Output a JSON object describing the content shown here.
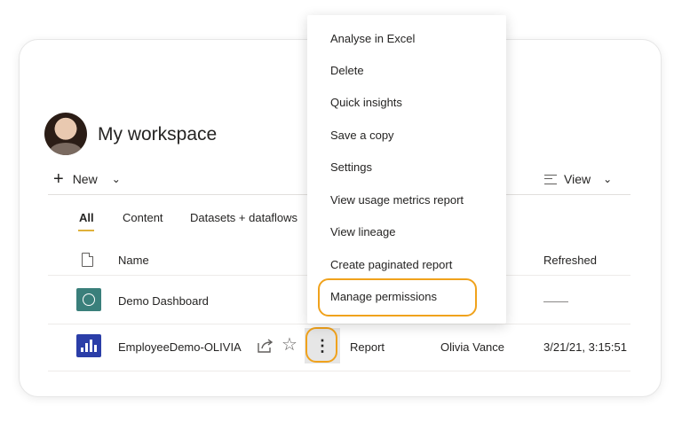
{
  "workspace": {
    "title": "My workspace"
  },
  "toolbar": {
    "new_label": "New",
    "plus": "+",
    "chevron": "⌄",
    "view_label": "View"
  },
  "tabs": [
    {
      "label": "All",
      "active": true
    },
    {
      "label": "Content",
      "active": false
    },
    {
      "label": "Datasets + dataflows",
      "active": false
    }
  ],
  "table": {
    "headers": {
      "name": "Name",
      "refreshed": "Refreshed"
    },
    "rows": [
      {
        "name": "Demo Dashboard",
        "type": "",
        "owner": "",
        "refreshed": ""
      },
      {
        "name": "EmployeeDemo-OLIVIA",
        "type": "Report",
        "owner": "Olivia Vance",
        "refreshed": "3/21/21, 3:15:51"
      }
    ]
  },
  "row_actions": {
    "more_glyph": "⋮",
    "star_glyph": "☆"
  },
  "context_menu": {
    "items": [
      "Analyse in Excel",
      "Delete",
      "Quick insights",
      "Save a copy",
      "Settings",
      "View usage metrics report",
      "View lineage",
      "Create paginated report",
      "Manage permissions"
    ]
  },
  "colors": {
    "highlight": "#f0a21c",
    "tab_underline": "#e0b13a",
    "dashboard_icon": "#3a7f7b",
    "report_icon": "#2b3ea8"
  }
}
